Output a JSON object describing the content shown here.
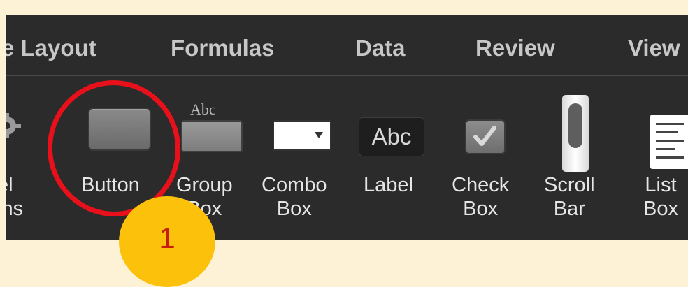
{
  "ribbon": {
    "tabs": [
      {
        "label": "e Layout"
      },
      {
        "label": "Formulas"
      },
      {
        "label": "Data"
      },
      {
        "label": "Review"
      },
      {
        "label": "View"
      }
    ],
    "left_clipped": {
      "line1": "el",
      "line2": "ins"
    },
    "controls": {
      "button": {
        "line1": "Button"
      },
      "group_box": {
        "line1": "Group",
        "line2": "Box",
        "icon_text": "Abc"
      },
      "combo_box": {
        "line1": "Combo",
        "line2": "Box"
      },
      "label": {
        "line1": "Label",
        "icon_text": "Abc"
      },
      "check_box": {
        "line1": "Check",
        "line2": "Box"
      },
      "scroll_bar": {
        "line1": "Scroll",
        "line2": "Bar"
      },
      "list_box": {
        "line1": "List",
        "line2": "Box"
      }
    }
  },
  "annotation": {
    "step": "1",
    "circle_color": "#e8111b",
    "badge_color": "#fcc10a"
  },
  "colors": {
    "background": "#fdf2d6",
    "ribbon": "#2b2b2b"
  }
}
